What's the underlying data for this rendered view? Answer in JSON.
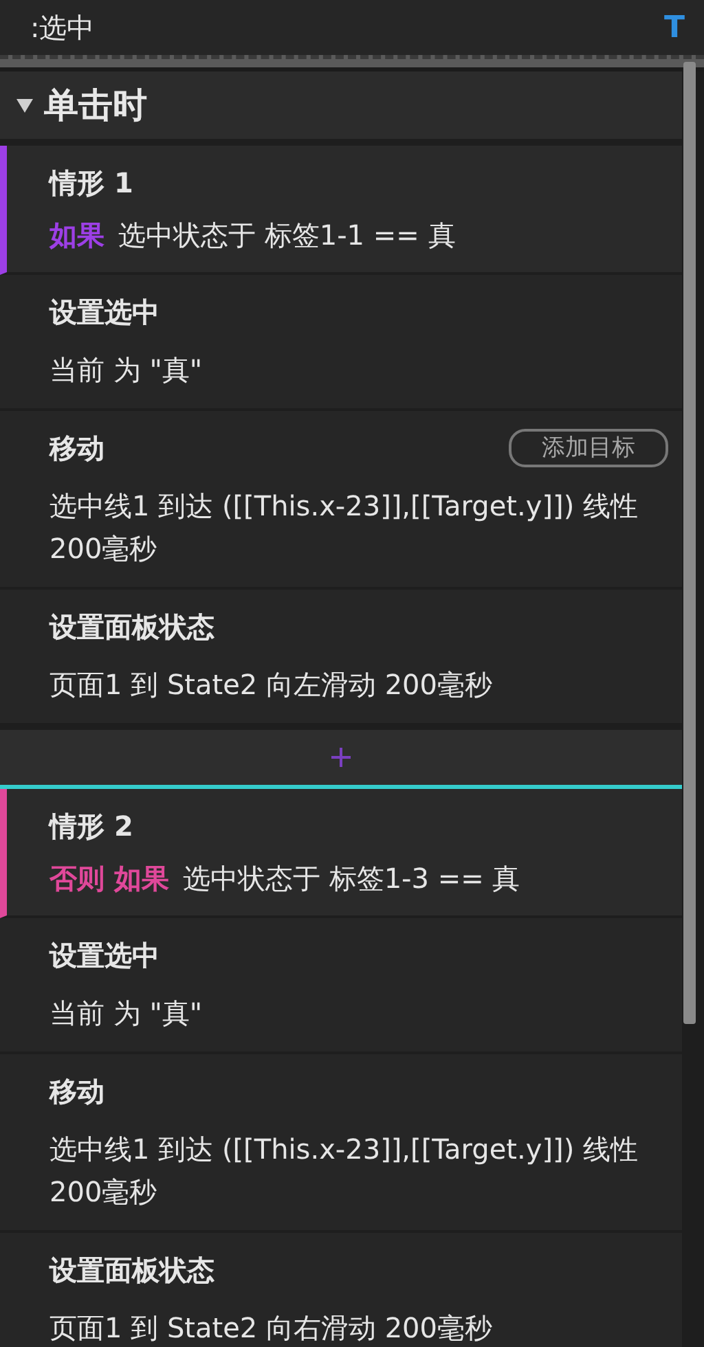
{
  "header": {
    "title": ":选中",
    "icon_text": "T"
  },
  "event": {
    "title": "单击时",
    "expanded": true,
    "cases": [
      {
        "title": "情形 1",
        "keyword": "如果",
        "condition": "选中状态于 标签1-1 == 真",
        "color": "#9d3fe6",
        "selected": false,
        "actions": [
          {
            "title": "设置选中",
            "detail": "当前 为 \"真\""
          },
          {
            "title": "移动",
            "detail": "选中线1 到达 ([[This.x-23]],[[Target.y]]) 线性 200毫秒",
            "button": "添加目标"
          },
          {
            "title": "设置面板状态",
            "detail": "页面1 到 State2 向左滑动 200毫秒"
          }
        ]
      },
      {
        "title": "情形 2",
        "keyword": "否则 如果",
        "condition": "选中状态于 标签1-3 == 真",
        "color": "#e0489a",
        "selected": true,
        "actions": [
          {
            "title": "设置选中",
            "detail": "当前 为 \"真\""
          },
          {
            "title": "移动",
            "detail": "选中线1 到达 ([[This.x-23]],[[Target.y]]) 线性 200毫秒"
          },
          {
            "title": "设置面板状态",
            "detail": "页面1 到 State2 向右滑动 200毫秒"
          }
        ]
      }
    ]
  }
}
